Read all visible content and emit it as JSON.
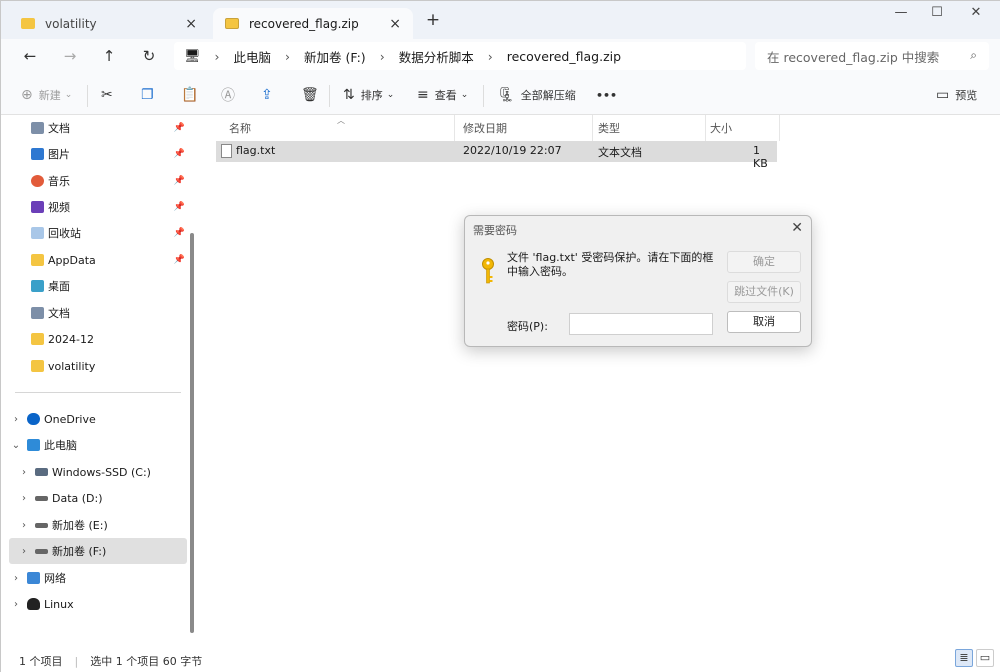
{
  "tabs": [
    {
      "label": "volatility",
      "close": "×"
    },
    {
      "label": "recovered_flag.zip",
      "close": "×"
    }
  ],
  "new_tab": "+",
  "window_controls": {
    "minimize": "—",
    "maximize": "☐",
    "close": "✕"
  },
  "nav": {
    "back": "←",
    "forward": "→",
    "up": "↑",
    "refresh": "↻"
  },
  "breadcrumb": [
    "此电脑",
    "新加卷 (F:)",
    "数据分析脚本",
    "recovered_flag.zip"
  ],
  "breadcrumb_sep": "›",
  "search": {
    "placeholder": "在 recovered_flag.zip 中搜索"
  },
  "toolbar": {
    "new": "新建",
    "sort": "排序",
    "view": "查看",
    "extract_all": "全部解压缩",
    "more": "•••",
    "preview": "预览"
  },
  "sidebar": {
    "items": [
      {
        "label": "文档",
        "icon": "document-icon",
        "pinned": true
      },
      {
        "label": "图片",
        "icon": "pictures-icon",
        "pinned": true
      },
      {
        "label": "音乐",
        "icon": "music-icon",
        "pinned": true
      },
      {
        "label": "视频",
        "icon": "video-icon",
        "pinned": true
      },
      {
        "label": "回收站",
        "icon": "recycle-bin-icon",
        "pinned": true
      },
      {
        "label": "AppData",
        "icon": "folder-icon",
        "pinned": true
      },
      {
        "label": "桌面",
        "icon": "desktop-icon",
        "pinned": false
      },
      {
        "label": "文档",
        "icon": "document-icon",
        "pinned": false
      },
      {
        "label": "2024-12",
        "icon": "folder-icon",
        "pinned": false
      },
      {
        "label": "volatility",
        "icon": "folder-icon",
        "pinned": false
      }
    ],
    "tree": [
      {
        "label": "OneDrive",
        "chevron": "›"
      },
      {
        "label": "此电脑",
        "chevron": "⌄"
      },
      {
        "label": "Windows-SSD (C:)",
        "chevron": "›"
      },
      {
        "label": "Data (D:)",
        "chevron": "›"
      },
      {
        "label": "新加卷 (E:)",
        "chevron": "›"
      },
      {
        "label": "新加卷 (F:)",
        "chevron": "›"
      },
      {
        "label": "网络",
        "chevron": "›"
      },
      {
        "label": "Linux",
        "chevron": "›"
      }
    ]
  },
  "columns": [
    "名称",
    "修改日期",
    "类型",
    "大小"
  ],
  "files": [
    {
      "name": "flag.txt",
      "modified": "2022/10/19 22:07",
      "type": "文本文档",
      "size": "1 KB"
    }
  ],
  "status": {
    "count": "1 个项目",
    "selected": "选中 1 个项目  60 字节"
  },
  "dialog": {
    "title": "需要密码",
    "message": "文件 'flag.txt' 受密码保护。请在下面的框中输入密码。",
    "password_label": "密码(P):",
    "password_value": "",
    "ok": "确定",
    "skip": "跳过文件(K)",
    "cancel": "取消"
  },
  "colors": {
    "folder": "#f4c542",
    "accent": "#0067c0",
    "selected_row": "#dcdcdc"
  }
}
